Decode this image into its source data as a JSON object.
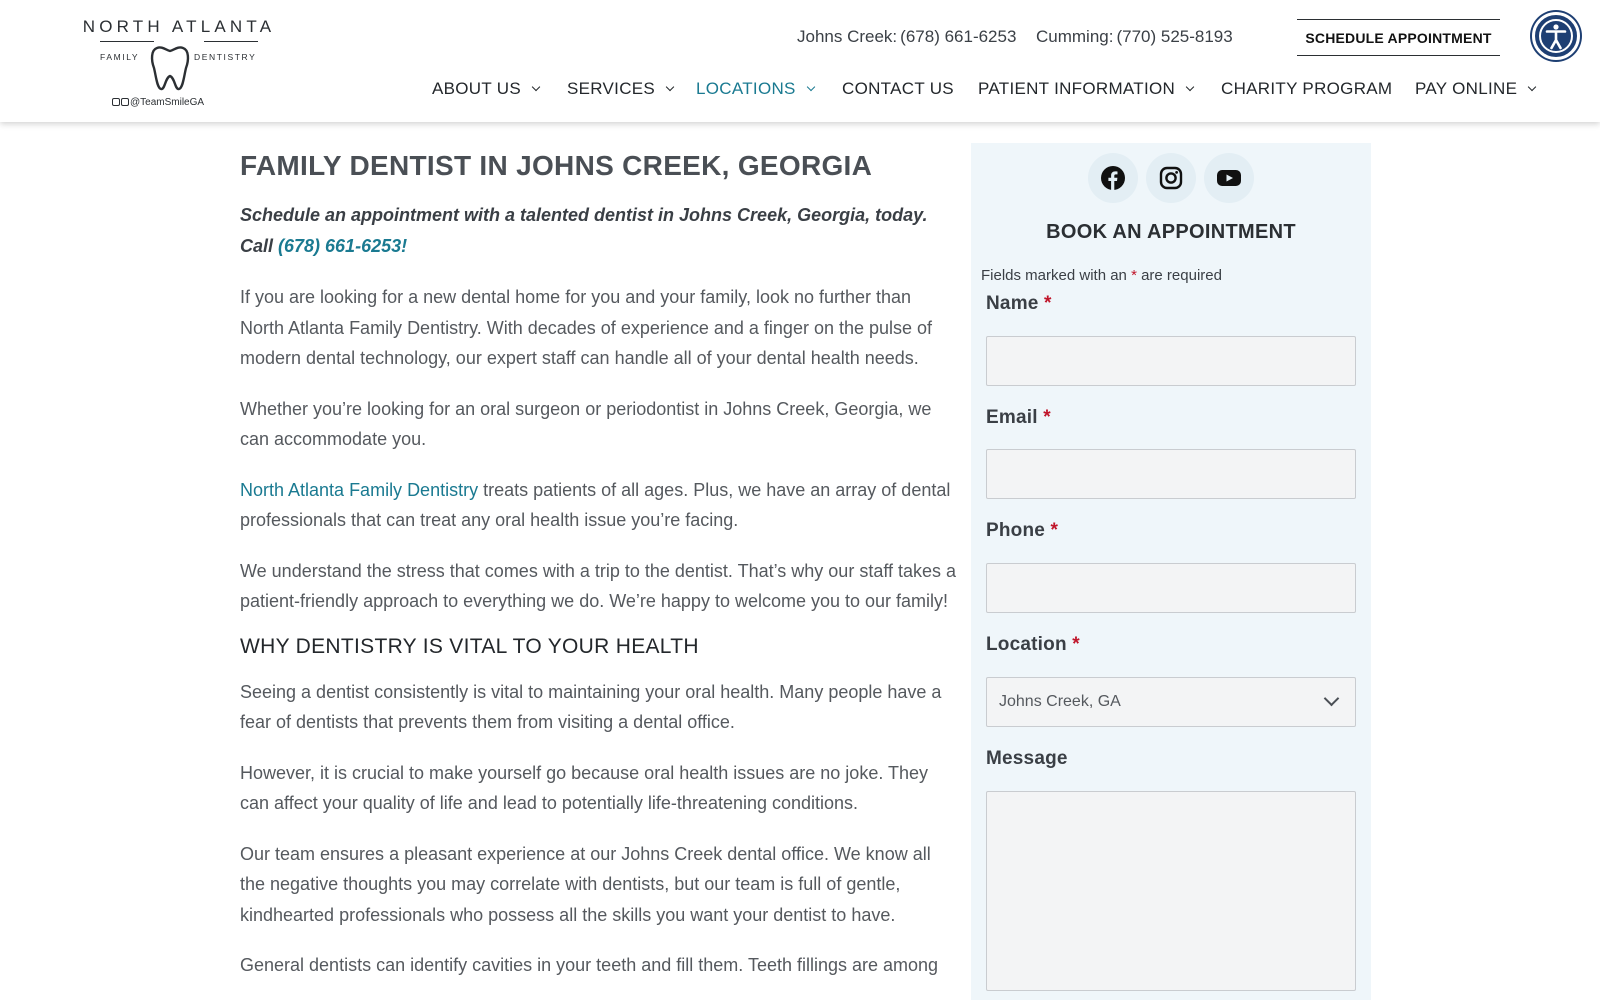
{
  "header": {
    "logo": {
      "top": "NORTH ATLANTA",
      "left": "FAMILY",
      "right": "DENTISTRY",
      "social_handle": "@TeamSmileGA"
    },
    "phones": [
      {
        "label": "Johns Creek:",
        "number": "(678) 661-6253"
      },
      {
        "label": "Cumming:",
        "number": "(770) 525-8193"
      }
    ],
    "schedule_button": "SCHEDULE APPOINTMENT",
    "accessibility_icon": "accessibility-icon",
    "nav": [
      {
        "label": "ABOUT US",
        "dropdown": true
      },
      {
        "label": "SERVICES",
        "dropdown": true
      },
      {
        "label": "LOCATIONS",
        "dropdown": true,
        "active": true
      },
      {
        "label": "CONTACT US",
        "dropdown": false
      },
      {
        "label": "PATIENT INFORMATION",
        "dropdown": true
      },
      {
        "label": "CHARITY PROGRAM",
        "dropdown": false
      },
      {
        "label": "PAY ONLINE",
        "dropdown": true
      }
    ]
  },
  "main": {
    "title": "FAMILY DENTIST IN JOHNS CREEK, GEORGIA",
    "lead_text": "Schedule an appointment with a talented dentist in Johns Creek, Georgia, today. Call ",
    "lead_phone": "(678) 661-6253",
    "lead_end": "!",
    "p1": "If you are looking for a new dental home for you and your family, look no further than North Atlanta Family Dentistry. With decades of experience and a finger on the pulse of modern dental technology, our expert staff can handle all of your dental health needs.",
    "p2": "Whether you’re looking for an oral surgeon or periodontist in Johns Creek, Georgia, we can accommodate you.",
    "p3_link": "North Atlanta Family Dentistry",
    "p3_rest": " treats patients of all ages. Plus, we have an array of dental professionals that can treat any oral health issue you’re facing.",
    "p4": "We understand the stress that comes with a trip to the dentist. That’s why our staff takes a patient-friendly approach to everything we do. We’re happy to welcome you to our family!",
    "h2": "WHY DENTISTRY IS VITAL TO YOUR HEALTH",
    "p5": "Seeing a dentist consistently is vital to maintaining your oral health. Many people have a fear of dentists that prevents them from visiting a dental office.",
    "p6": "However, it is crucial to make yourself go because oral health issues are no joke. They can affect your quality of life and lead to potentially life-threatening conditions.",
    "p7": "Our team ensures a pleasant experience at our Johns Creek dental office. We know all the negative thoughts you may correlate with dentists, but our team is full of gentle, kindhearted professionals who possess all the skills you want your dentist to have.",
    "p8": "General dentists can identify cavities in your teeth and fill them. Teeth fillings are among"
  },
  "sidebar": {
    "social_icons": [
      "facebook-icon",
      "instagram-icon",
      "youtube-icon"
    ],
    "title": "BOOK AN APPOINTMENT",
    "required_note_pre": "Fields marked with an ",
    "required_star": "*",
    "required_note_post": " are required",
    "fields": {
      "name": "Name",
      "email": "Email",
      "phone": "Phone",
      "location": "Location",
      "location_value": "Johns Creek, GA",
      "message": "Message"
    },
    "star": "*"
  },
  "colors": {
    "accent": "#1a7a91",
    "text": "#4a4f55",
    "sidebar_bg": "#eff6fa",
    "required": "#c0152a",
    "accessibility": "#1e3f73"
  }
}
